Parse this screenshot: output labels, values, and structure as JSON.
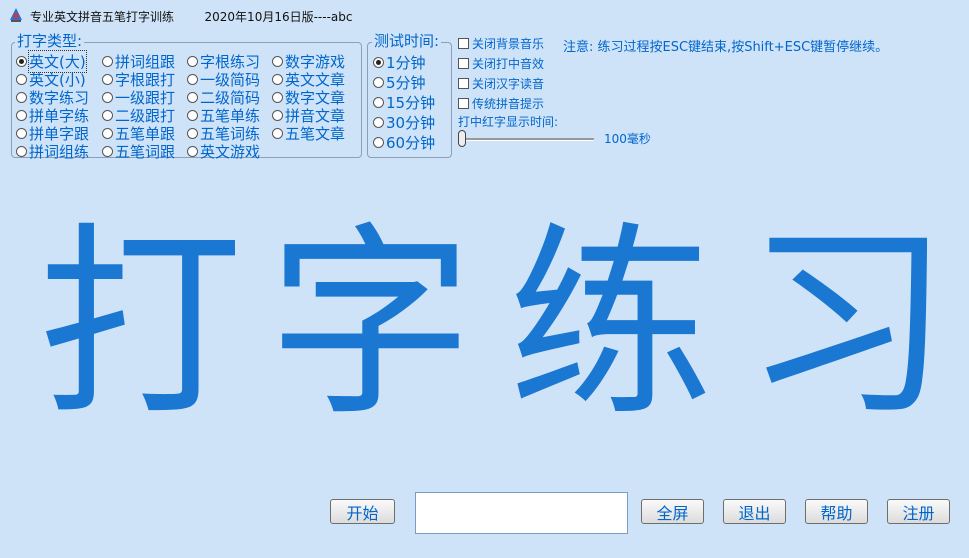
{
  "window": {
    "title": "专业英文拼音五笔打字训练        2020年10月16日版----abc"
  },
  "typing_types": {
    "legend": "打字类型:",
    "columns": [
      [
        "英文(大)",
        "英文(小)",
        "数字练习",
        "拼单字练",
        "拼单字跟",
        "拼词组练"
      ],
      [
        "拼词组跟",
        "字根跟打",
        "一级跟打",
        "二级跟打",
        "五笔单跟",
        "五笔词跟"
      ],
      [
        "字根练习",
        "一级简码",
        "二级简码",
        "五笔单练",
        "五笔词练",
        "英文游戏"
      ],
      [
        "数字游戏",
        "英文文章",
        "数字文章",
        "拼音文章",
        "五笔文章"
      ]
    ],
    "selected": "英文(大)"
  },
  "test_time": {
    "legend": "测试时间:",
    "options": [
      "1分钟",
      "5分钟",
      "15分钟",
      "30分钟",
      "60分钟"
    ],
    "selected": "1分钟"
  },
  "options": {
    "checks": [
      "关闭背景音乐",
      "关闭打中音效",
      "关闭汉字读音",
      "传统拼音提示"
    ],
    "note": "注意: 练习过程按ESC键结束,按Shift+ESC键暂停继续。",
    "red_time_label": "打中红字显示时间:",
    "red_time_value": "100毫秒"
  },
  "display": {
    "chars": [
      "打",
      "字",
      "练",
      "习"
    ]
  },
  "input": {
    "value": ""
  },
  "buttons": {
    "start": "开始",
    "fullscreen": "全屏",
    "exit": "退出",
    "help": "帮助",
    "register": "注册"
  }
}
